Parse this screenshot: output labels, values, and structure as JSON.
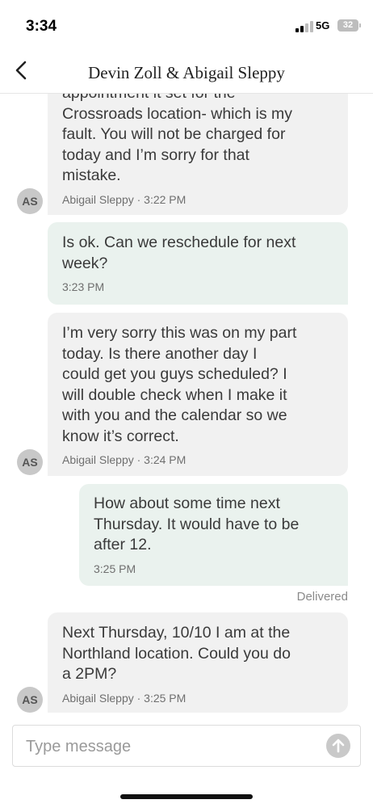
{
  "status_bar": {
    "time": "3:34",
    "network": "5G",
    "battery": "32"
  },
  "header": {
    "title": "Devin Zoll & Abigail Sleppy"
  },
  "messages": [
    {
      "direction": "in",
      "text": "appointment it set for the\nCrossroads location- which is my\nfault. You will not be charged for\ntoday and I’m sorry for that\nmistake.",
      "meta": "Abigail Sleppy · 3:22 PM",
      "avatar": "AS"
    },
    {
      "direction": "out",
      "text": "Is ok. Can we reschedule for next\nweek?",
      "meta": "3:23 PM"
    },
    {
      "direction": "in",
      "text": "I’m very sorry this was on my part\ntoday. Is there another day I\ncould get you guys scheduled? I\nwill double check when I make it\nwith you and the calendar so we\nknow it’s correct.",
      "meta": "Abigail Sleppy · 3:24 PM",
      "avatar": "AS"
    },
    {
      "direction": "out",
      "text": "How about some time next\nThursday. It would have to be\nafter 12.",
      "meta": "3:25 PM"
    },
    {
      "direction": "in",
      "text": "Next Thursday, 10/10 I am at the\nNorthland location. Could you do\na 2PM?",
      "meta": "Abigail Sleppy · 3:25 PM",
      "avatar": "AS"
    }
  ],
  "delivered_label": "Delivered",
  "composer": {
    "placeholder": "Type message"
  }
}
